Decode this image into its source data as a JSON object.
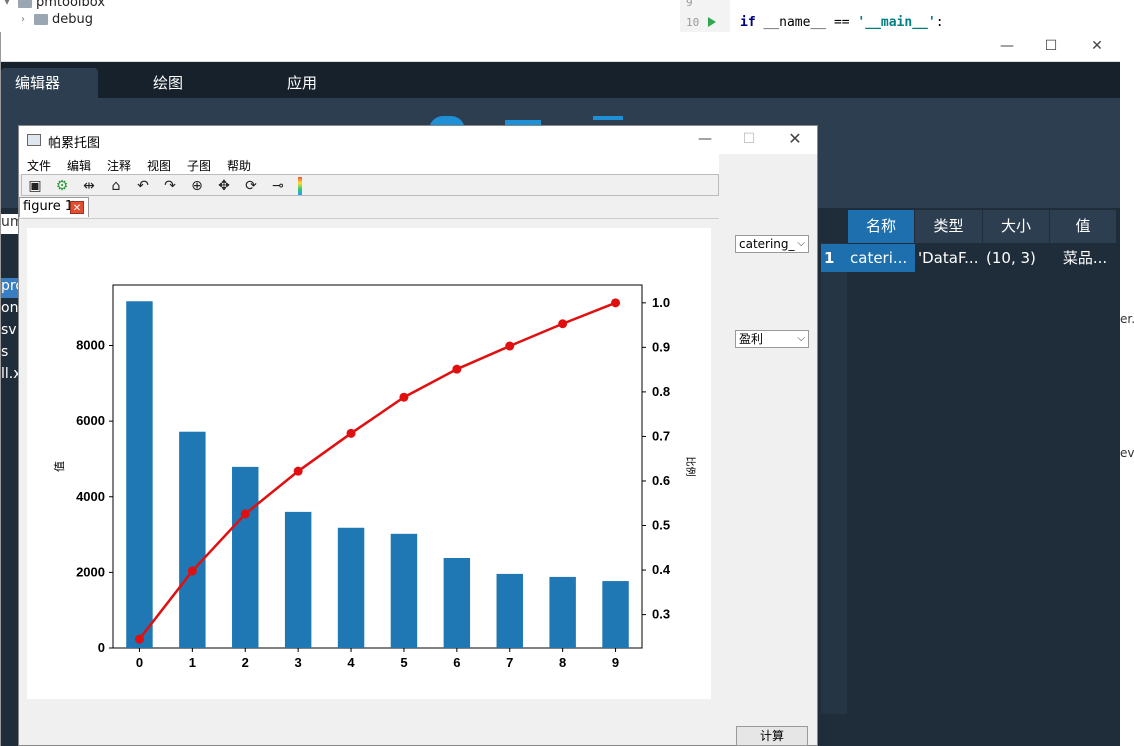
{
  "background": {
    "tree": [
      {
        "label": "pmtoolbox"
      },
      {
        "label": "debug"
      }
    ],
    "code": {
      "line_numbers": [
        "9",
        "10"
      ],
      "kw_if": "if",
      "name_var": "__name__",
      "op": "==",
      "main_str": "'__main__'",
      "colon": ":"
    },
    "left_fragments": [
      "um",
      "pro",
      "ong",
      "sv",
      "s",
      "ll.x"
    ],
    "right_fragments": [
      "er.",
      "ev."
    ]
  },
  "app": {
    "tabs": [
      {
        "label": "编辑器",
        "active": true
      },
      {
        "label": "绘图",
        "active": false
      },
      {
        "label": "应用",
        "active": false
      }
    ],
    "window_controls": {
      "minimize": "—",
      "maximize": "☐",
      "close": "✕"
    },
    "scroll_up": "▲"
  },
  "variables": {
    "headers": [
      "名称",
      "类型",
      "大小",
      "值"
    ],
    "rows": [
      {
        "index": "1",
        "name": "cateri...",
        "type": "'DataF...",
        "size": "(10, 3)",
        "value": "菜品..."
      }
    ]
  },
  "figure_window": {
    "title": "帕累托图",
    "controls": {
      "minimize": "—",
      "maximize": "☐",
      "close": "✕"
    },
    "menus": [
      "文件",
      "编辑",
      "注释",
      "视图",
      "子图",
      "帮助"
    ],
    "toolbar_icons": [
      "save-icon",
      "settings-icon",
      "split-icon",
      "home-icon",
      "back-icon",
      "forward-icon",
      "zoom-icon",
      "pan-icon",
      "3d-rotate-icon",
      "marker-icon",
      "colorbar-icon"
    ],
    "tab_label": "figure 1",
    "select_dataset": "catering_",
    "select_column": "盈利",
    "calc_button": "计算"
  },
  "chart_data": {
    "type": "bar",
    "categories": [
      "0",
      "1",
      "2",
      "3",
      "4",
      "5",
      "6",
      "7",
      "8",
      "9"
    ],
    "series": [
      {
        "values": [
          9170,
          5720,
          4790,
          3600,
          3180,
          3020,
          2380,
          1960,
          1880,
          1770
        ],
        "axis": "left",
        "color": "#1f77b4",
        "kind": "bar"
      },
      {
        "values": [
          0.245,
          0.398,
          0.526,
          0.622,
          0.707,
          0.788,
          0.851,
          0.903,
          0.953,
          1.0
        ],
        "axis": "right",
        "color": "#e01010",
        "kind": "line"
      }
    ],
    "ylabel": "值",
    "y2label": "比例",
    "ylim": [
      0,
      9600
    ],
    "y2lim": [
      0.225,
      1.04
    ],
    "yticks": [
      "0",
      "2000",
      "4000",
      "6000",
      "8000"
    ],
    "y2ticks": [
      "0.3",
      "0.4",
      "0.5",
      "0.6",
      "0.7",
      "0.8",
      "0.9",
      "1.0"
    ],
    "grid": false
  }
}
